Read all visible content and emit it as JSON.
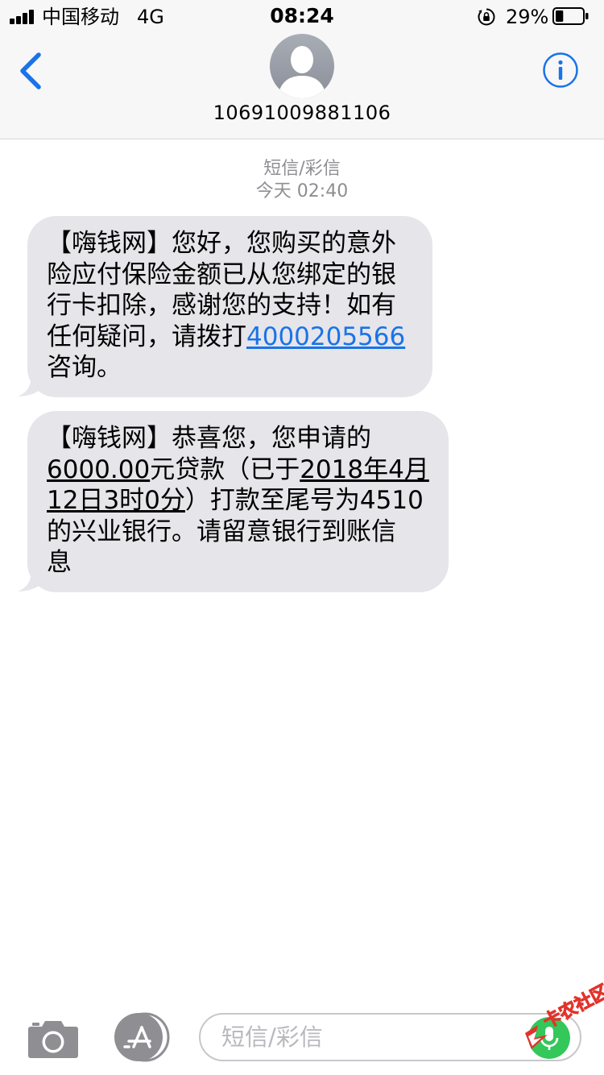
{
  "status_bar": {
    "carrier": "中国移动",
    "network": "4G",
    "time": "08:24",
    "battery_percent": "29%",
    "battery_level": 0.29
  },
  "header": {
    "contact_number": "10691009881106",
    "back_icon": "chevron-left-icon",
    "info_icon": "info-icon"
  },
  "conversation": {
    "type_label": "短信/彩信",
    "timestamp": "今天 02:40"
  },
  "messages": [
    {
      "lines": [
        "【嗨钱网】您好，您购买的意外",
        "险应付保险金额已从您绑定的银",
        "行卡扣除，感谢您的支持！如有",
        "任何疑问，请拨打",
        "咨询。"
      ],
      "phone_link": "4000205566"
    },
    {
      "line1": "【嗨钱网】恭喜您，您申请的",
      "amount": "6000.00",
      "line2_mid": "元贷款（已于",
      "date_year": "2018年4月",
      "date_day": "12日3时0分",
      "line3_rest": "）打款至尾号为4510",
      "line4": "的兴业银行。请留意银行到账信",
      "line5": "息"
    }
  ],
  "input_bar": {
    "placeholder": "短信/彩信",
    "camera_icon": "camera-icon",
    "appstore_icon": "app-store-icon",
    "mic_icon": "microphone-icon"
  },
  "watermark": {
    "text": "卡农社区"
  },
  "colors": {
    "accent_blue": "#1a73e8",
    "bubble_gray": "#e5e5ea",
    "meta_gray": "#8e8e93",
    "mic_green": "#34c759"
  }
}
